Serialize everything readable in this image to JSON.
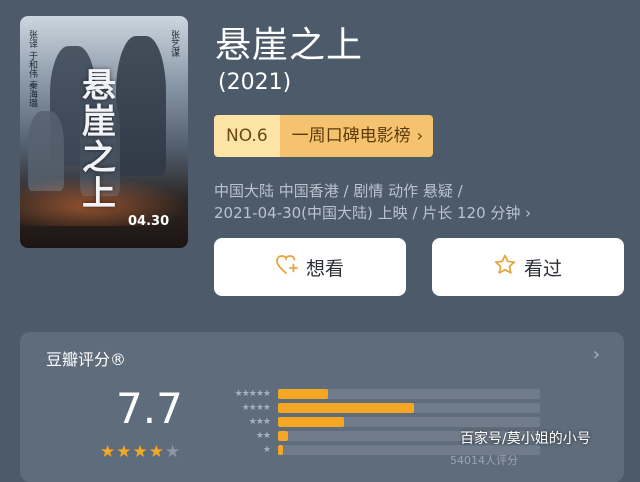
{
  "poster": {
    "title_art": "悬崖之上",
    "date_art": "04.30",
    "cast_left": "张译 于和伟 秦海璐",
    "cast_right": "张艺谋"
  },
  "movie": {
    "title": "悬崖之上",
    "year": "(2021)"
  },
  "rank": {
    "number": "NO.6",
    "label": "一周口碑电影榜",
    "chevron": "›"
  },
  "meta": {
    "line1": "中国大陆 中国香港 / 剧情 动作 悬疑 /",
    "line2": "2021-04-30(中国大陆) 上映 / 片长 120 分钟 ›"
  },
  "buttons": {
    "want_label": "想看",
    "want_icon": "heart-plus-icon",
    "seen_label": "看过",
    "seen_icon": "star-icon"
  },
  "rating": {
    "header": "豆瓣评分®",
    "chevron": "›",
    "score": "7.7",
    "stars_full": 4,
    "stars_total": 5,
    "distribution": [
      {
        "stars": 5,
        "fraction": 0.19
      },
      {
        "stars": 4,
        "fraction": 0.52
      },
      {
        "stars": 3,
        "fraction": 0.25
      },
      {
        "stars": 2,
        "fraction": 0.04
      },
      {
        "stars": 1,
        "fraction": 0.02
      }
    ],
    "count_text": "54014人评分"
  },
  "watermark": "百家号/莫小姐的小号",
  "colors": {
    "background": "#4d5a69",
    "accent": "#f5a623",
    "rank_light": "#fce4a6",
    "rank_dark": "#f5c36f"
  }
}
